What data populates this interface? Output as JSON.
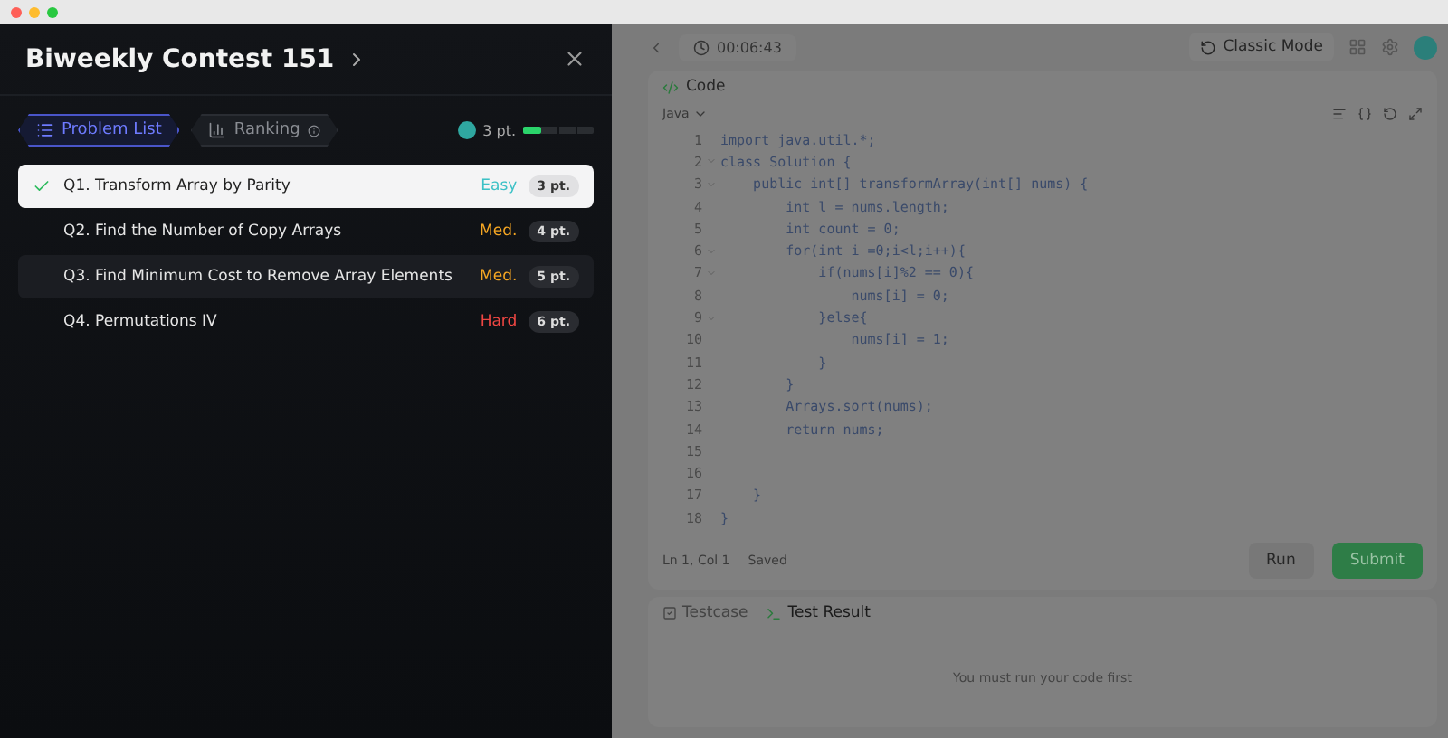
{
  "drawer": {
    "title": "Biweekly Contest 151",
    "tabs": [
      {
        "label": "Problem List",
        "selected": true,
        "kind": "list"
      },
      {
        "label": "Ranking",
        "selected": false,
        "kind": "ranking"
      }
    ],
    "score": {
      "points": "3 pt.",
      "level": 0.25
    },
    "problems": [
      {
        "title": "Q1. Transform Array by Parity",
        "difficulty": "Easy",
        "points": "3 pt.",
        "solved": true,
        "selected": true
      },
      {
        "title": "Q2. Find the Number of Copy Arrays",
        "difficulty": "Med.",
        "points": "4 pt.",
        "solved": false,
        "selected": false
      },
      {
        "title": "Q3. Find Minimum Cost to Remove Array Elements",
        "difficulty": "Med.",
        "points": "5 pt.",
        "solved": false,
        "selected": false
      },
      {
        "title": "Q4. Permutations IV",
        "difficulty": "Hard",
        "points": "6 pt.",
        "solved": false,
        "selected": false
      }
    ]
  },
  "editor": {
    "timer": "00:06:43",
    "mode": "Classic Mode",
    "panel_title": "Code",
    "language": "Java",
    "lines": [
      {
        "number": "1",
        "text": "import java.util.*;",
        "foldable": false
      },
      {
        "number": "2",
        "text": "class Solution {",
        "foldable": true
      },
      {
        "number": "3",
        "text": "    public int[] transformArray(int[] nums) {",
        "foldable": true
      },
      {
        "number": "4",
        "text": "        int l = nums.length;",
        "foldable": false
      },
      {
        "number": "5",
        "text": "        int count = 0;",
        "foldable": false
      },
      {
        "number": "6",
        "text": "        for(int i =0;i<l;i++){",
        "foldable": true
      },
      {
        "number": "7",
        "text": "            if(nums[i]%2 == 0){",
        "foldable": true
      },
      {
        "number": "8",
        "text": "                nums[i] = 0;",
        "foldable": false
      },
      {
        "number": "9",
        "text": "            }else{",
        "foldable": true
      },
      {
        "number": "10",
        "text": "                nums[i] = 1;",
        "foldable": false
      },
      {
        "number": "11",
        "text": "            }",
        "foldable": false
      },
      {
        "number": "12",
        "text": "        }",
        "foldable": false
      },
      {
        "number": "13",
        "text": "        Arrays.sort(nums);",
        "foldable": false
      },
      {
        "number": "14",
        "text": "        return nums;",
        "foldable": false
      },
      {
        "number": "15",
        "foldable": false
      },
      {
        "number": "16",
        "foldable": false
      },
      {
        "number": "17",
        "text": "    }",
        "foldable": false
      },
      {
        "number": "18",
        "text": "}",
        "foldable": false
      }
    ],
    "cursor": "Ln 1, Col 1",
    "save_state": "Saved",
    "run": "Run",
    "submit": "Submit",
    "bottom_tabs": [
      {
        "label": "Testcase",
        "selected": false,
        "kind": "testcase"
      },
      {
        "label": "Test Result",
        "selected": true,
        "kind": "result"
      }
    ],
    "empty_message": "You must run your code first"
  }
}
